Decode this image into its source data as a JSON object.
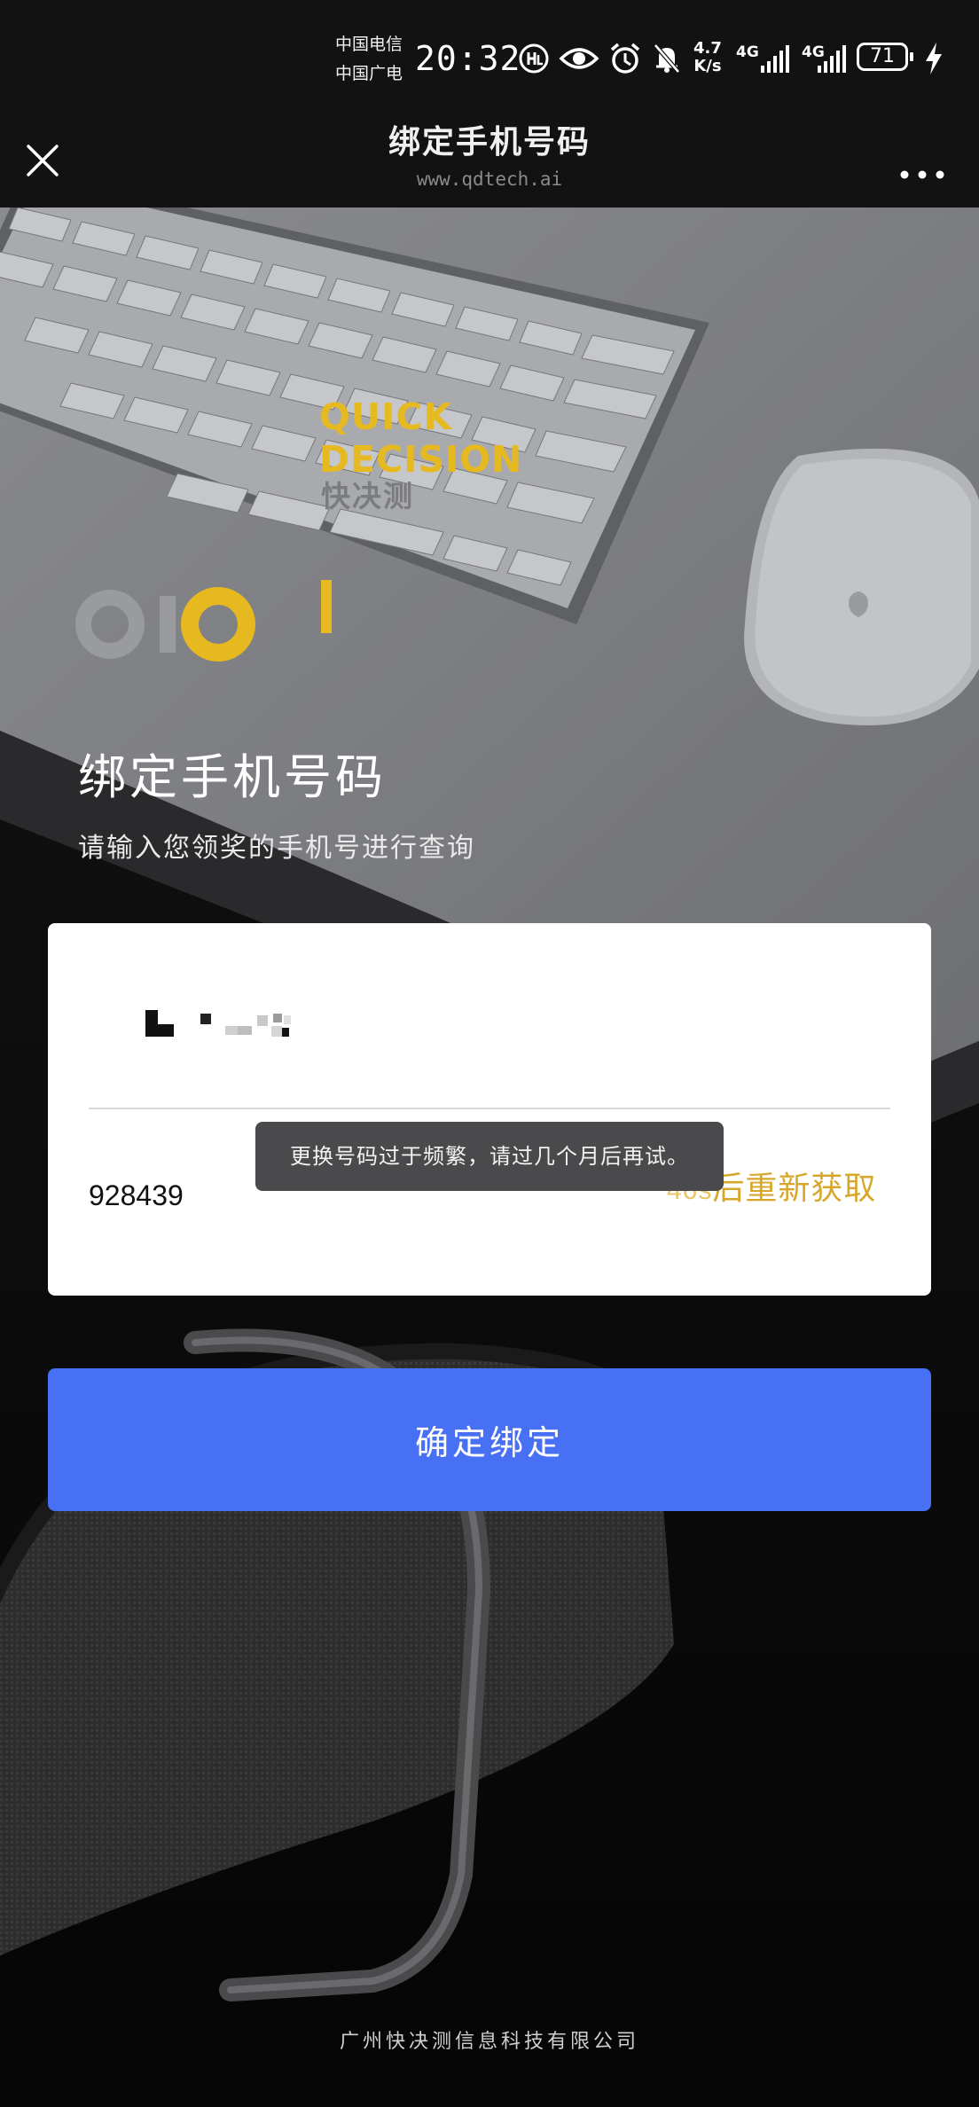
{
  "status_bar": {
    "carrier_1": "中国电信",
    "carrier_2": "中国广电",
    "time": "20:32",
    "net_speed_value": "4.7",
    "net_speed_unit": "K/s",
    "signal_1_label": "4G",
    "signal_2_label": "4G",
    "battery": "71",
    "icons": [
      "hd-voice-icon",
      "eye-icon",
      "alarm-icon",
      "mute-icon",
      "signal-icon",
      "signal-icon",
      "battery-icon",
      "charging-icon"
    ]
  },
  "nav": {
    "title": "绑定手机号码",
    "url": "www.qdtech.ai",
    "close_icon": "close-icon",
    "more_icon": "more-icon"
  },
  "brand": {
    "name_line1": "QUICK",
    "name_line2": "DECISION",
    "name_cn": "快决测",
    "accent": "#e6b920"
  },
  "page": {
    "heading": "绑定手机号码",
    "subheading": "请输入您领奖的手机号进行查询"
  },
  "form": {
    "code_value": "928439",
    "resend_seconds": "46s",
    "resend_text": "后重新获取"
  },
  "toast": {
    "message": "更换号码过于频繁，请过几个月后再试。"
  },
  "submit": {
    "label": "确定绑定",
    "color": "#4870f5"
  },
  "footer": {
    "company": "广州快决测信息科技有限公司"
  }
}
